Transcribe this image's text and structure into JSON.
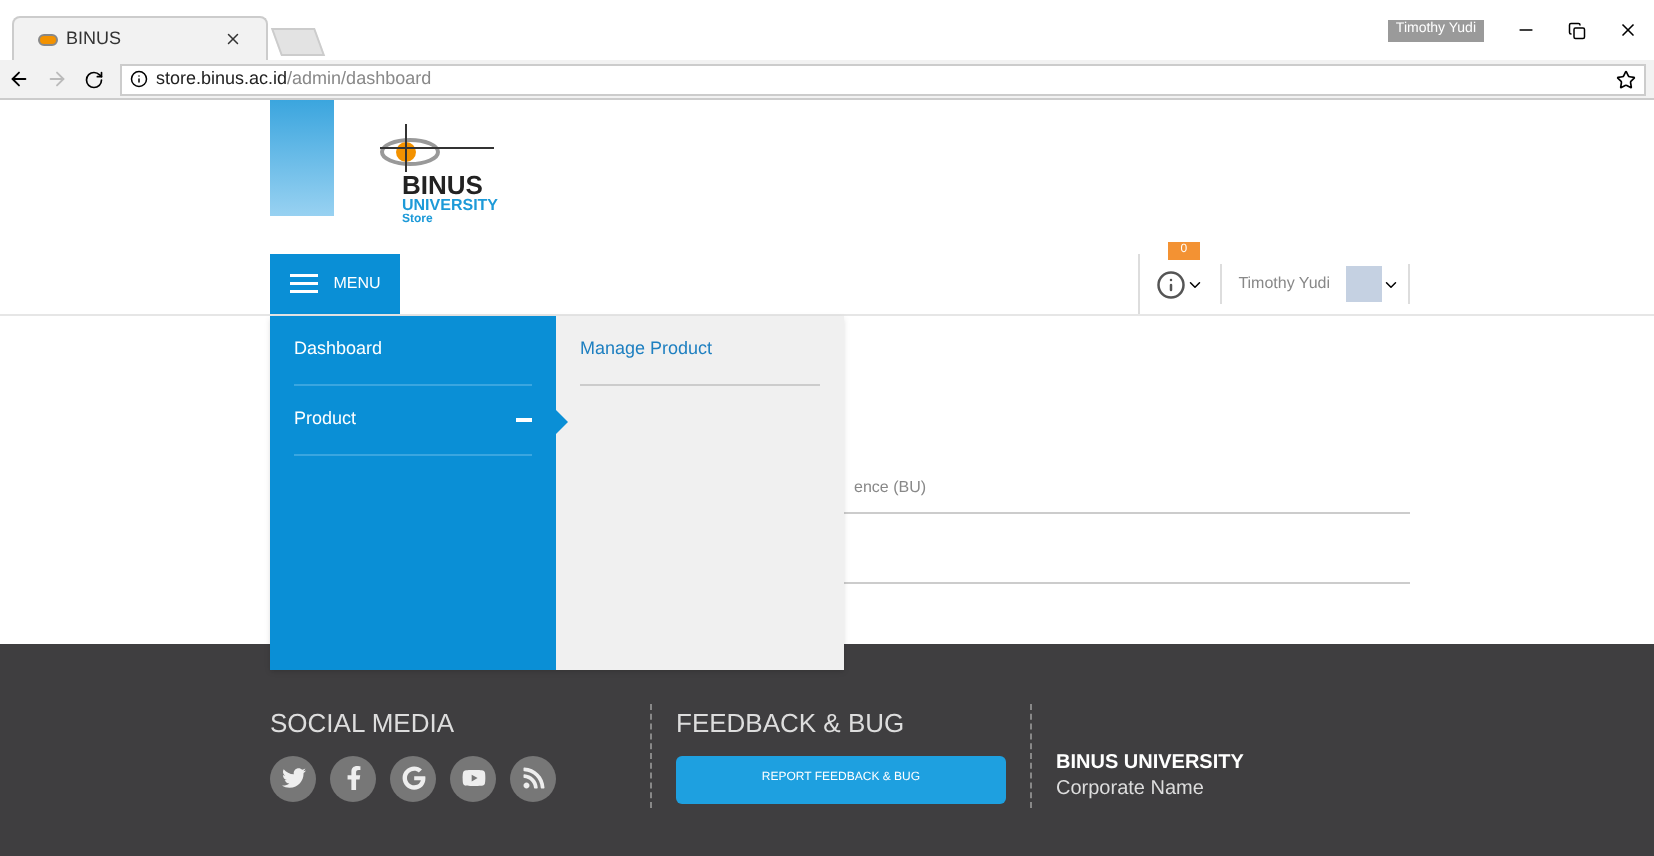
{
  "browser": {
    "tab_title": "BINUS",
    "profile": "Timothy Yudi",
    "url_host": "store.binus.ac.id",
    "url_path": "/admin/dashboard"
  },
  "logo": {
    "name": "BINUS",
    "line2": "UNIVERSITY",
    "line3": "Store"
  },
  "header": {
    "menu_label": "MENU",
    "notification_count": "0",
    "user_name": "Timothy Yudi"
  },
  "menu": {
    "items": [
      {
        "label": "Dashboard",
        "expanded": false
      },
      {
        "label": "Product",
        "expanded": true,
        "children": [
          {
            "label": "Manage Product"
          }
        ]
      }
    ]
  },
  "content": {
    "partial_label": "ence (BU)"
  },
  "footer": {
    "social_title": "SOCIAL MEDIA",
    "social": [
      {
        "kind": "twitter"
      },
      {
        "kind": "facebook"
      },
      {
        "kind": "google"
      },
      {
        "kind": "youtube"
      },
      {
        "kind": "rss"
      }
    ],
    "feedback_title": "FEEDBACK & BUG",
    "feedback_button": "REPORT FEEDBACK & BUG",
    "org_name": "BINUS UNIVERSITY",
    "org_sub": "Corporate Name"
  }
}
